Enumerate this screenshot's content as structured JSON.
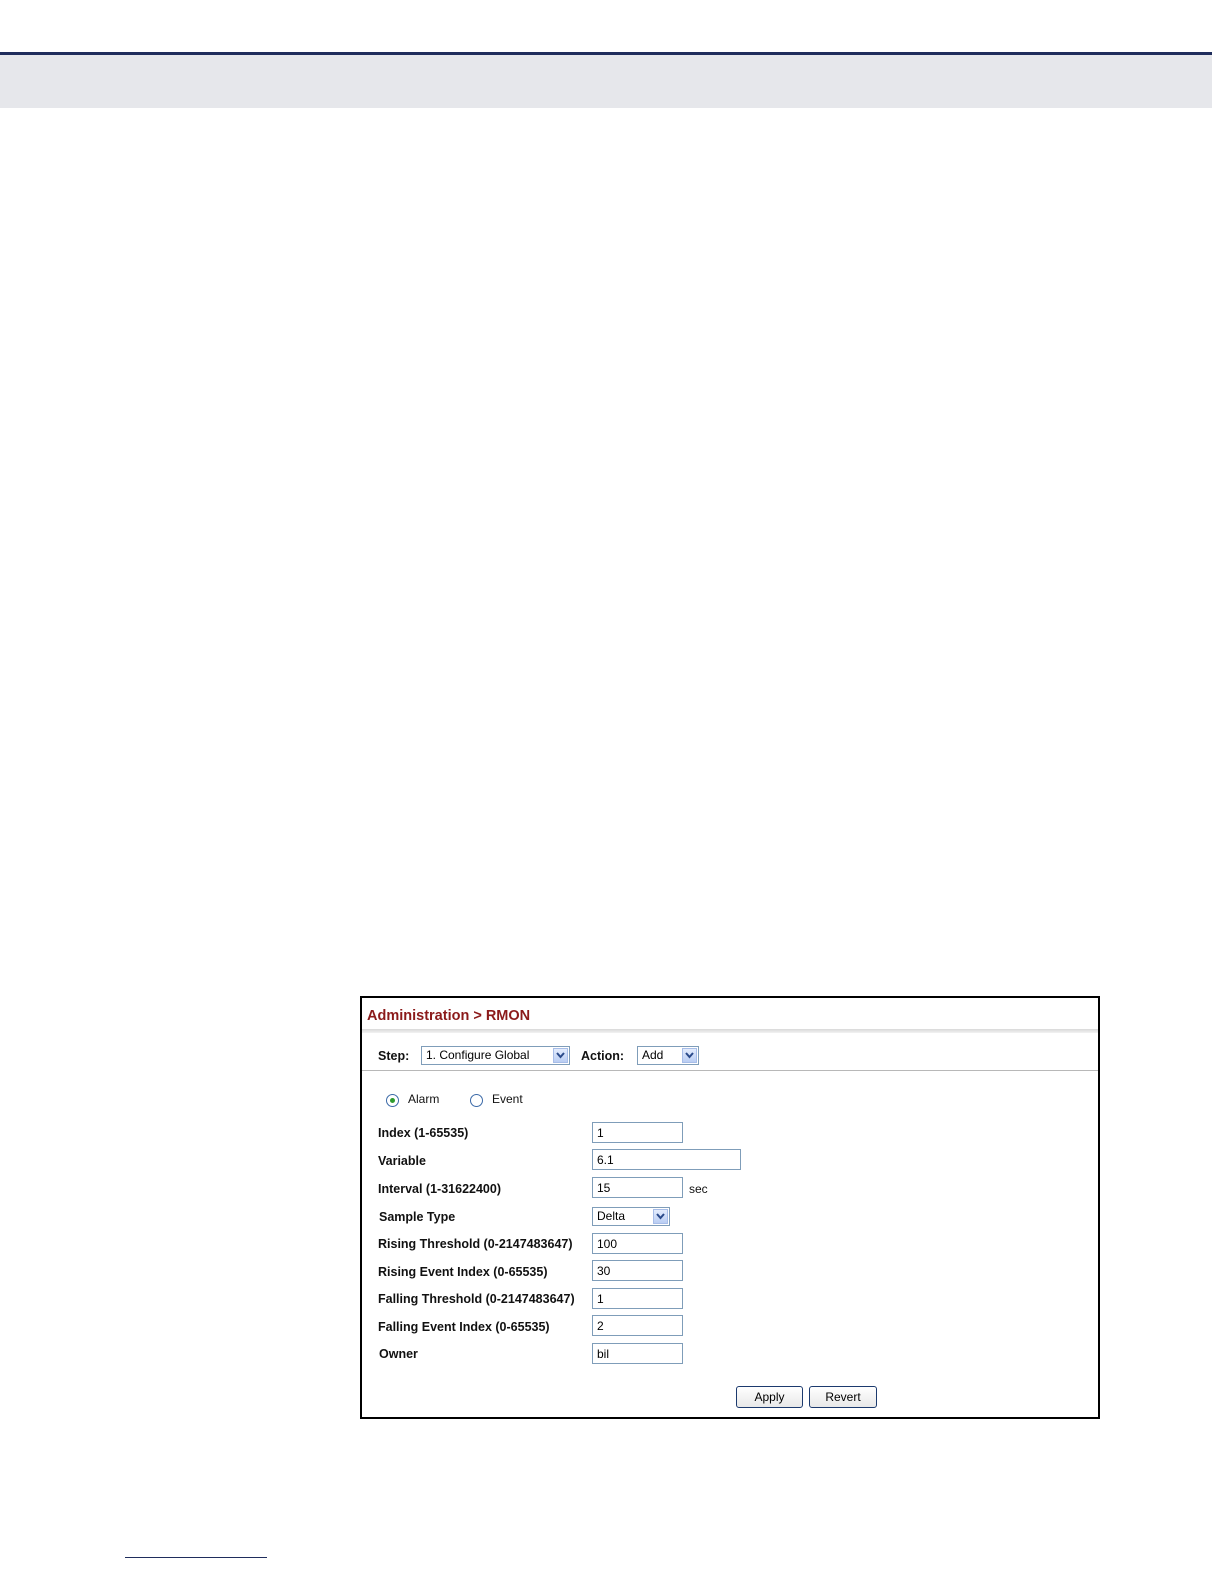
{
  "form": {
    "title": "Administration > RMON",
    "step_label": "Step:",
    "step_value": "1. Configure Global",
    "action_label": "Action:",
    "action_value": "Add",
    "radio_alarm": "Alarm",
    "radio_event": "Event",
    "selected_radio": "Alarm",
    "fields": {
      "index": {
        "label": "Index (1-65535)",
        "value": "1"
      },
      "variable": {
        "label": "Variable",
        "value": "6.1"
      },
      "interval": {
        "label": "Interval (1-31622400)",
        "value": "15",
        "unit": "sec"
      },
      "sample_type": {
        "label": "Sample Type",
        "value": "Delta"
      },
      "rising_threshold": {
        "label": "Rising Threshold (0-2147483647)",
        "value": "100"
      },
      "rising_event_index": {
        "label": "Rising Event Index (0-65535)",
        "value": "30"
      },
      "falling_threshold": {
        "label": "Falling Threshold (0-2147483647)",
        "value": "1"
      },
      "falling_event_index": {
        "label": "Falling Event Index (0-65535)",
        "value": "2"
      },
      "owner": {
        "label": "Owner",
        "value": "bil"
      }
    },
    "apply_label": "Apply",
    "revert_label": "Revert"
  },
  "colors": {
    "title": "#8b1a1a",
    "header_band": "#e6e7eb",
    "header_line": "#1f2d5c",
    "radio_dot": "#2e9b2e"
  }
}
